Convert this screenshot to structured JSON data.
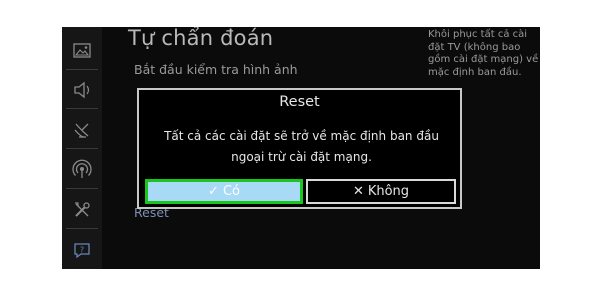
{
  "screen": {
    "title": "Tự chẩn đoán",
    "menu_items": [
      {
        "label": "Bắt đầu kiểm tra hình ảnh",
        "style": "normal"
      },
      {
        "label": "Reset",
        "style": "blue"
      }
    ],
    "help_text": "Khôi phục tất cả cài đặt TV (không bao gồm cài đặt mạng) về mặc định ban đầu."
  },
  "sidebar": {
    "icons": [
      "picture-icon",
      "sound-icon",
      "broadcast-icon",
      "network-icon",
      "tools-icon",
      "support-icon"
    ]
  },
  "dialog": {
    "title": "Reset",
    "message": "Tất cả các cài đặt sẽ trở về mặc định ban đầu ngoại trừ cài đặt mạng.",
    "yes_label": "Có",
    "no_label": "Không",
    "yes_icon": "check-icon",
    "no_icon": "x-icon"
  },
  "colors": {
    "focus_border": "#1ac51e",
    "yes_fill": "#a8d9f5",
    "background": "#0b0b0b"
  }
}
